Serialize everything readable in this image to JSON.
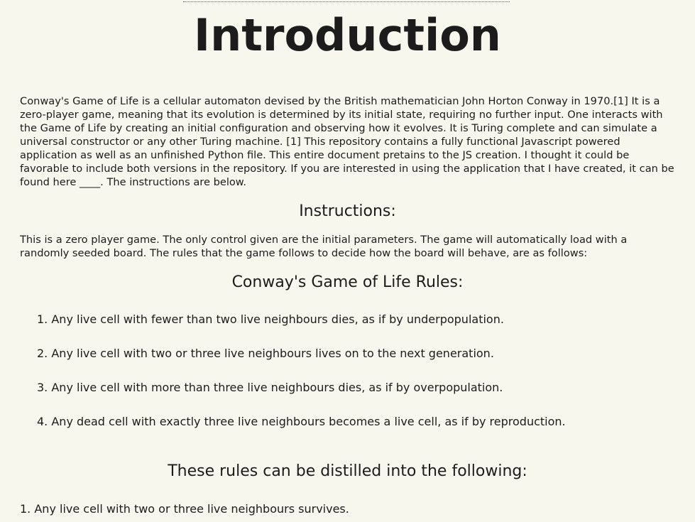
{
  "title": "Introduction",
  "intro_paragraph": "Conway's Game of Life is a cellular automaton devised by the British mathematician John Horton Conway in 1970.[1] It is a zero-player game, meaning that its evolution is determined by its initial state, requiring no further input. One interacts with the Game of Life by creating an initial configuration and observing how it evolves. It is Turing complete and can simulate a universal constructor or any other Turing machine. [1] This repository contains a fully functional Javascript powered application as well as an unfinished Python file. This entire document pretains to the JS creation. I thought it could be favorable to include both versions in the repository. If you are interested in using the application that I have created, it can be found here ____. The instructions are below.",
  "instructions": {
    "heading": "Instructions:",
    "text": "This is a zero player game. The only control given are the initial parameters. The game will automatically load with a randomly seeded board. The rules that the game follows to decide how the board will behave, are as follows:"
  },
  "rules": {
    "heading": "Conway's Game of Life Rules:",
    "items": [
      {
        "num": "1.",
        "text": "Any live cell with fewer than two live neighbours dies, as if by underpopulation."
      },
      {
        "num": "2.",
        "text": "Any live cell with two or three live neighbours lives on to the next generation."
      },
      {
        "num": "3.",
        "text": "Any live cell with more than three live neighbours dies, as if by overpopulation."
      },
      {
        "num": "4.",
        "text": "Any dead cell with exactly three live neighbours becomes a live cell, as if by reproduction."
      }
    ]
  },
  "distilled": {
    "heading": "These rules can be distilled into the following:",
    "items": [
      {
        "num": "1.",
        "text": "Any live cell with two or three live neighbours survives."
      }
    ]
  }
}
